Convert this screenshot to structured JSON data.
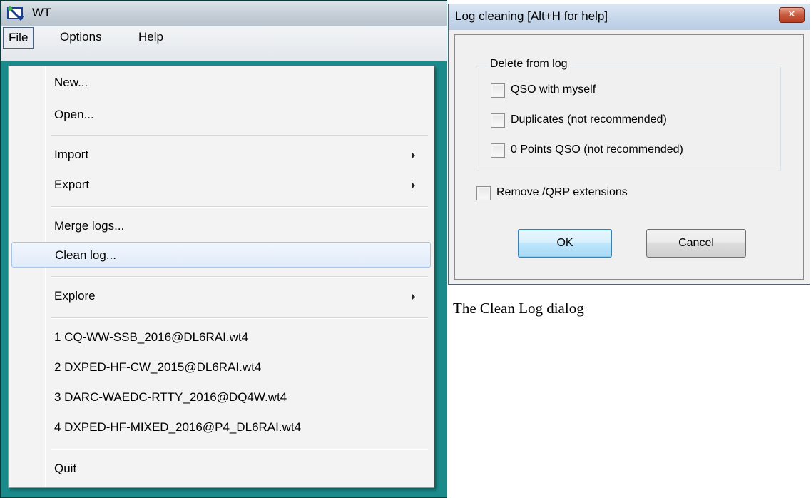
{
  "main_window": {
    "title": "WT",
    "menubar": {
      "file": "File",
      "options": "Options",
      "help": "Help"
    },
    "file_menu": {
      "items": [
        {
          "label": "New...",
          "submenu": false
        },
        {
          "label": "Open...",
          "submenu": false
        },
        {
          "label": "Import",
          "submenu": true
        },
        {
          "label": "Export",
          "submenu": true
        },
        {
          "label": "Merge logs...",
          "submenu": false
        },
        {
          "label": "Clean log...",
          "submenu": false,
          "highlighted": true
        },
        {
          "label": "Explore",
          "submenu": true
        },
        {
          "label": "1 CQ-WW-SSB_2016@DL6RAI.wt4",
          "submenu": false
        },
        {
          "label": "2 DXPED-HF-CW_2015@DL6RAI.wt4",
          "submenu": false
        },
        {
          "label": "3 DARC-WAEDC-RTTY_2016@DQ4W.wt4",
          "submenu": false
        },
        {
          "label": "4 DXPED-HF-MIXED_2016@P4_DL6RAI.wt4",
          "submenu": false
        },
        {
          "label": "Quit",
          "submenu": false
        }
      ]
    }
  },
  "dialog": {
    "title": "Log cleaning [Alt+H for help]",
    "close_glyph": "✕",
    "groupbox_label": "Delete from log",
    "options": [
      {
        "label": "QSO with myself",
        "checked": false
      },
      {
        "label": "Duplicates (not recommended)",
        "checked": false
      },
      {
        "label": "0 Points QSO (not recommended)",
        "checked": false
      }
    ],
    "remove_qrp": {
      "label": "Remove /QRP extensions",
      "checked": false
    },
    "ok_label": "OK",
    "cancel_label": "Cancel"
  },
  "caption": "The Clean Log dialog",
  "colors": {
    "workspace_teal": "#1a8a8a",
    "menu_highlight_border": "#a9c4e8",
    "close_button_red": "#c75a3e"
  },
  "icons": [
    "app-icon",
    "submenu-arrow-icon",
    "close-icon",
    "checkbox-icon"
  ]
}
